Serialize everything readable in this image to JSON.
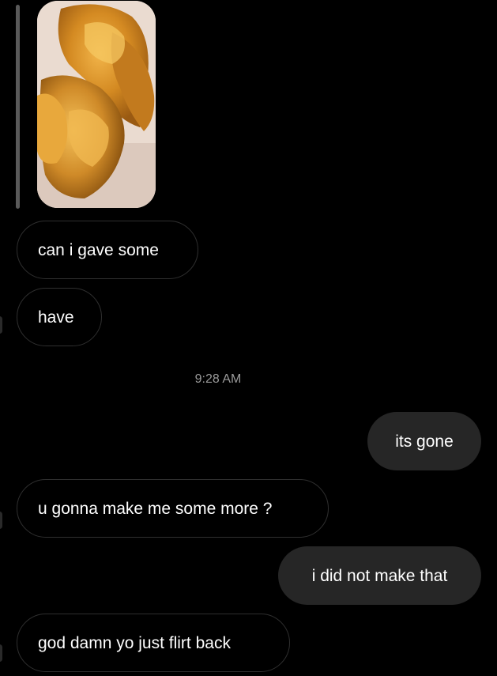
{
  "thread": {
    "timestamp": "9:28 AM",
    "messages": [
      {
        "id": "m1",
        "from": "them",
        "text": "can i gave some"
      },
      {
        "id": "m2",
        "from": "them",
        "text": "have"
      },
      {
        "id": "m3",
        "from": "me",
        "text": "its gone"
      },
      {
        "id": "m4",
        "from": "them",
        "text": "u gonna make me some more ?"
      },
      {
        "id": "m5",
        "from": "me",
        "text": "i did not make that"
      },
      {
        "id": "m6",
        "from": "them",
        "text": "god damn yo just flirt back"
      }
    ]
  }
}
